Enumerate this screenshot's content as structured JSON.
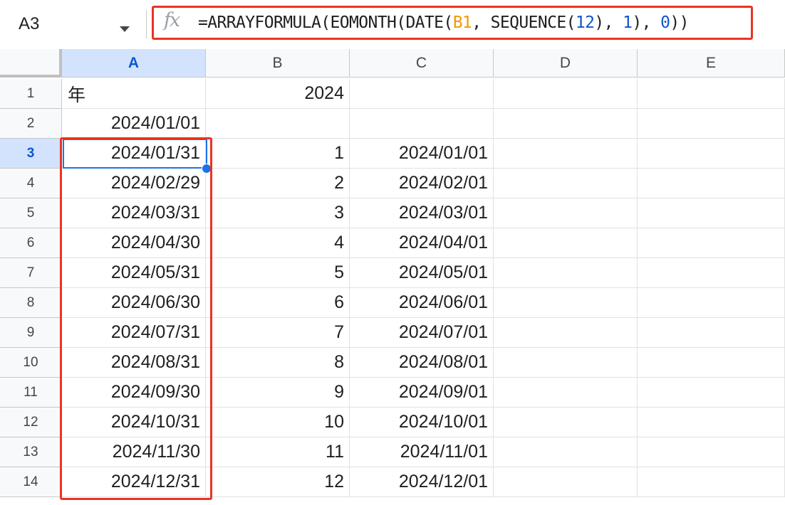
{
  "formula_bar": {
    "name_box": "A3",
    "fx_label": "fx",
    "formula_parts": {
      "p1": "=ARRAYFORMULA(EOMONTH(DATE(",
      "ref": "B1",
      "p2": ", SEQUENCE(",
      "n12": "12",
      "p3": "), ",
      "n1": "1",
      "p4": "), ",
      "n0": "0",
      "p5": "))"
    }
  },
  "columns": [
    "A",
    "B",
    "C",
    "D",
    "E"
  ],
  "rows": [
    {
      "num": "1",
      "a": "年",
      "b": "2024",
      "c": ""
    },
    {
      "num": "2",
      "a": "2024/01/01",
      "b": "",
      "c": ""
    },
    {
      "num": "3",
      "a": "2024/01/31",
      "b": "1",
      "c": "2024/01/01"
    },
    {
      "num": "4",
      "a": "2024/02/29",
      "b": "2",
      "c": "2024/02/01"
    },
    {
      "num": "5",
      "a": "2024/03/31",
      "b": "3",
      "c": "2024/03/01"
    },
    {
      "num": "6",
      "a": "2024/04/30",
      "b": "4",
      "c": "2024/04/01"
    },
    {
      "num": "7",
      "a": "2024/05/31",
      "b": "5",
      "c": "2024/05/01"
    },
    {
      "num": "8",
      "a": "2024/06/30",
      "b": "6",
      "c": "2024/06/01"
    },
    {
      "num": "9",
      "a": "2024/07/31",
      "b": "7",
      "c": "2024/07/01"
    },
    {
      "num": "10",
      "a": "2024/08/31",
      "b": "8",
      "c": "2024/08/01"
    },
    {
      "num": "11",
      "a": "2024/09/30",
      "b": "9",
      "c": "2024/09/01"
    },
    {
      "num": "12",
      "a": "2024/10/31",
      "b": "10",
      "c": "2024/10/01"
    },
    {
      "num": "13",
      "a": "2024/11/30",
      "b": "11",
      "c": "2024/11/01"
    },
    {
      "num": "14",
      "a": "2024/12/31",
      "b": "12",
      "c": "2024/12/01"
    }
  ],
  "selection": {
    "active_cell": "A3",
    "active_row": "3",
    "active_column": "A"
  },
  "colors": {
    "highlight": "#ea3323",
    "selection": "#1a73e8",
    "ref_orange": "#f29900",
    "number_blue": "#1155cc"
  }
}
